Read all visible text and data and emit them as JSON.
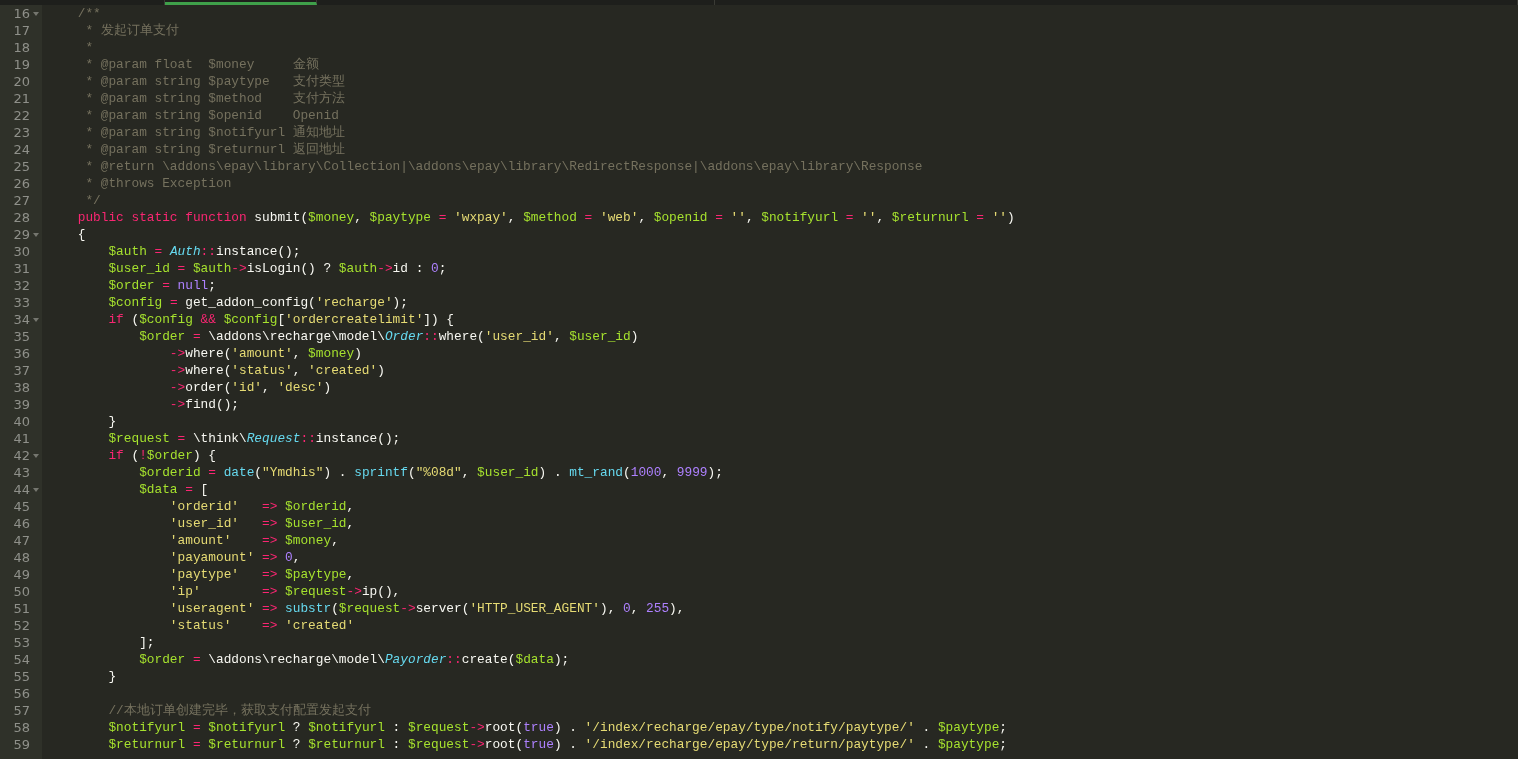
{
  "tabs": [
    {
      "selected": false
    },
    {
      "selected": true
    },
    {
      "selected": false
    },
    {
      "selected": false
    }
  ],
  "lines": [
    {
      "number": "16",
      "fold": true,
      "tokens": [
        {
          "kind": "comment",
          "text": "    /**"
        }
      ]
    },
    {
      "number": "17",
      "fold": false,
      "tokens": [
        {
          "kind": "comment",
          "text": "     * 发起订单支付"
        }
      ]
    },
    {
      "number": "18",
      "fold": false,
      "tokens": [
        {
          "kind": "comment",
          "text": "     *"
        }
      ]
    },
    {
      "number": "19",
      "fold": false,
      "tokens": [
        {
          "kind": "comment",
          "text": "     * @param float  $money     金额"
        }
      ]
    },
    {
      "number": "20",
      "fold": false,
      "tokens": [
        {
          "kind": "comment",
          "text": "     * @param string $paytype   支付类型"
        }
      ]
    },
    {
      "number": "21",
      "fold": false,
      "tokens": [
        {
          "kind": "comment",
          "text": "     * @param string $method    支付方法"
        }
      ]
    },
    {
      "number": "22",
      "fold": false,
      "tokens": [
        {
          "kind": "comment",
          "text": "     * @param string $openid    Openid"
        }
      ]
    },
    {
      "number": "23",
      "fold": false,
      "tokens": [
        {
          "kind": "comment",
          "text": "     * @param string $notifyurl 通知地址"
        }
      ]
    },
    {
      "number": "24",
      "fold": false,
      "tokens": [
        {
          "kind": "comment",
          "text": "     * @param string $returnurl 返回地址"
        }
      ]
    },
    {
      "number": "25",
      "fold": false,
      "tokens": [
        {
          "kind": "comment",
          "text": "     * @return \\addons\\epay\\library\\Collection|\\addons\\epay\\library\\RedirectResponse|\\addons\\epay\\library\\Response"
        }
      ]
    },
    {
      "number": "26",
      "fold": false,
      "tokens": [
        {
          "kind": "comment",
          "text": "     * @throws Exception"
        }
      ]
    },
    {
      "number": "27",
      "fold": false,
      "tokens": [
        {
          "kind": "comment",
          "text": "     */"
        }
      ]
    },
    {
      "number": "28",
      "fold": false,
      "tokens": [
        {
          "kind": "keyword",
          "text": "    public static function"
        },
        {
          "kind": "plain",
          "text": " submit("
        },
        {
          "kind": "variable",
          "text": "$money"
        },
        {
          "kind": "plain",
          "text": ", "
        },
        {
          "kind": "variable",
          "text": "$paytype"
        },
        {
          "kind": "keyword",
          "text": " = "
        },
        {
          "kind": "string",
          "text": "'wxpay'"
        },
        {
          "kind": "plain",
          "text": ", "
        },
        {
          "kind": "variable",
          "text": "$method"
        },
        {
          "kind": "keyword",
          "text": " = "
        },
        {
          "kind": "string",
          "text": "'web'"
        },
        {
          "kind": "plain",
          "text": ", "
        },
        {
          "kind": "variable",
          "text": "$openid"
        },
        {
          "kind": "keyword",
          "text": " = "
        },
        {
          "kind": "string",
          "text": "''"
        },
        {
          "kind": "plain",
          "text": ", "
        },
        {
          "kind": "variable",
          "text": "$notifyurl"
        },
        {
          "kind": "keyword",
          "text": " = "
        },
        {
          "kind": "string",
          "text": "''"
        },
        {
          "kind": "plain",
          "text": ", "
        },
        {
          "kind": "variable",
          "text": "$returnurl"
        },
        {
          "kind": "keyword",
          "text": " = "
        },
        {
          "kind": "string",
          "text": "''"
        },
        {
          "kind": "plain",
          "text": ")"
        }
      ]
    },
    {
      "number": "29",
      "fold": true,
      "tokens": [
        {
          "kind": "plain",
          "text": "    {"
        }
      ]
    },
    {
      "number": "30",
      "fold": false,
      "tokens": [
        {
          "kind": "variable",
          "text": "        $auth"
        },
        {
          "kind": "keyword",
          "text": " = "
        },
        {
          "kind": "class",
          "text": "Auth"
        },
        {
          "kind": "keyword",
          "text": "::"
        },
        {
          "kind": "plain",
          "text": "instance();"
        }
      ]
    },
    {
      "number": "31",
      "fold": false,
      "tokens": [
        {
          "kind": "variable",
          "text": "        $user_id"
        },
        {
          "kind": "keyword",
          "text": " = "
        },
        {
          "kind": "variable",
          "text": "$auth"
        },
        {
          "kind": "keyword",
          "text": "->"
        },
        {
          "kind": "plain",
          "text": "isLogin() ? "
        },
        {
          "kind": "variable",
          "text": "$auth"
        },
        {
          "kind": "keyword",
          "text": "->"
        },
        {
          "kind": "plain",
          "text": "id : "
        },
        {
          "kind": "number",
          "text": "0"
        },
        {
          "kind": "plain",
          "text": ";"
        }
      ]
    },
    {
      "number": "32",
      "fold": false,
      "tokens": [
        {
          "kind": "variable",
          "text": "        $order"
        },
        {
          "kind": "keyword",
          "text": " = "
        },
        {
          "kind": "number",
          "text": "null"
        },
        {
          "kind": "plain",
          "text": ";"
        }
      ]
    },
    {
      "number": "33",
      "fold": false,
      "tokens": [
        {
          "kind": "variable",
          "text": "        $config"
        },
        {
          "kind": "keyword",
          "text": " = "
        },
        {
          "kind": "plain",
          "text": "get_addon_config("
        },
        {
          "kind": "string",
          "text": "'recharge'"
        },
        {
          "kind": "plain",
          "text": ");"
        }
      ]
    },
    {
      "number": "34",
      "fold": true,
      "tokens": [
        {
          "kind": "keyword",
          "text": "        if"
        },
        {
          "kind": "plain",
          "text": " ("
        },
        {
          "kind": "variable",
          "text": "$config"
        },
        {
          "kind": "keyword",
          "text": " && "
        },
        {
          "kind": "variable",
          "text": "$config"
        },
        {
          "kind": "plain",
          "text": "["
        },
        {
          "kind": "string",
          "text": "'ordercreatelimit'"
        },
        {
          "kind": "plain",
          "text": "]) {"
        }
      ]
    },
    {
      "number": "35",
      "fold": false,
      "tokens": [
        {
          "kind": "variable",
          "text": "            $order"
        },
        {
          "kind": "keyword",
          "text": " = "
        },
        {
          "kind": "plain",
          "text": "\\addons\\recharge\\model\\"
        },
        {
          "kind": "class",
          "text": "Order"
        },
        {
          "kind": "keyword",
          "text": "::"
        },
        {
          "kind": "plain",
          "text": "where("
        },
        {
          "kind": "string",
          "text": "'user_id'"
        },
        {
          "kind": "plain",
          "text": ", "
        },
        {
          "kind": "variable",
          "text": "$user_id"
        },
        {
          "kind": "plain",
          "text": ")"
        }
      ]
    },
    {
      "number": "36",
      "fold": false,
      "tokens": [
        {
          "kind": "keyword",
          "text": "                ->"
        },
        {
          "kind": "plain",
          "text": "where("
        },
        {
          "kind": "string",
          "text": "'amount'"
        },
        {
          "kind": "plain",
          "text": ", "
        },
        {
          "kind": "variable",
          "text": "$money"
        },
        {
          "kind": "plain",
          "text": ")"
        }
      ]
    },
    {
      "number": "37",
      "fold": false,
      "tokens": [
        {
          "kind": "keyword",
          "text": "                ->"
        },
        {
          "kind": "plain",
          "text": "where("
        },
        {
          "kind": "string",
          "text": "'status'"
        },
        {
          "kind": "plain",
          "text": ", "
        },
        {
          "kind": "string",
          "text": "'created'"
        },
        {
          "kind": "plain",
          "text": ")"
        }
      ]
    },
    {
      "number": "38",
      "fold": false,
      "tokens": [
        {
          "kind": "keyword",
          "text": "                ->"
        },
        {
          "kind": "plain",
          "text": "order("
        },
        {
          "kind": "string",
          "text": "'id'"
        },
        {
          "kind": "plain",
          "text": ", "
        },
        {
          "kind": "string",
          "text": "'desc'"
        },
        {
          "kind": "plain",
          "text": ")"
        }
      ]
    },
    {
      "number": "39",
      "fold": false,
      "tokens": [
        {
          "kind": "keyword",
          "text": "                ->"
        },
        {
          "kind": "plain",
          "text": "find();"
        }
      ]
    },
    {
      "number": "40",
      "fold": false,
      "tokens": [
        {
          "kind": "plain",
          "text": "        }"
        }
      ]
    },
    {
      "number": "41",
      "fold": false,
      "tokens": [
        {
          "kind": "variable",
          "text": "        $request"
        },
        {
          "kind": "keyword",
          "text": " = "
        },
        {
          "kind": "plain",
          "text": "\\think\\"
        },
        {
          "kind": "class",
          "text": "Request"
        },
        {
          "kind": "keyword",
          "text": "::"
        },
        {
          "kind": "plain",
          "text": "instance();"
        }
      ]
    },
    {
      "number": "42",
      "fold": true,
      "tokens": [
        {
          "kind": "keyword",
          "text": "        if"
        },
        {
          "kind": "plain",
          "text": " ("
        },
        {
          "kind": "keyword",
          "text": "!"
        },
        {
          "kind": "variable",
          "text": "$order"
        },
        {
          "kind": "plain",
          "text": ") {"
        }
      ]
    },
    {
      "number": "43",
      "fold": false,
      "tokens": [
        {
          "kind": "variable",
          "text": "            $orderid"
        },
        {
          "kind": "keyword",
          "text": " = "
        },
        {
          "kind": "function",
          "text": "date"
        },
        {
          "kind": "plain",
          "text": "("
        },
        {
          "kind": "string",
          "text": "\"Ymdhis\""
        },
        {
          "kind": "plain",
          "text": ") . "
        },
        {
          "kind": "function",
          "text": "sprintf"
        },
        {
          "kind": "plain",
          "text": "("
        },
        {
          "kind": "string",
          "text": "\"%08d\""
        },
        {
          "kind": "plain",
          "text": ", "
        },
        {
          "kind": "variable",
          "text": "$user_id"
        },
        {
          "kind": "plain",
          "text": ") . "
        },
        {
          "kind": "function",
          "text": "mt_rand"
        },
        {
          "kind": "plain",
          "text": "("
        },
        {
          "kind": "number",
          "text": "1000"
        },
        {
          "kind": "plain",
          "text": ", "
        },
        {
          "kind": "number",
          "text": "9999"
        },
        {
          "kind": "plain",
          "text": ");"
        }
      ]
    },
    {
      "number": "44",
      "fold": true,
      "tokens": [
        {
          "kind": "variable",
          "text": "            $data"
        },
        {
          "kind": "keyword",
          "text": " = "
        },
        {
          "kind": "plain",
          "text": "["
        }
      ]
    },
    {
      "number": "45",
      "fold": false,
      "tokens": [
        {
          "kind": "string",
          "text": "                'orderid'"
        },
        {
          "kind": "keyword",
          "text": "   => "
        },
        {
          "kind": "variable",
          "text": "$orderid"
        },
        {
          "kind": "plain",
          "text": ","
        }
      ]
    },
    {
      "number": "46",
      "fold": false,
      "tokens": [
        {
          "kind": "string",
          "text": "                'user_id'"
        },
        {
          "kind": "keyword",
          "text": "   => "
        },
        {
          "kind": "variable",
          "text": "$user_id"
        },
        {
          "kind": "plain",
          "text": ","
        }
      ]
    },
    {
      "number": "47",
      "fold": false,
      "tokens": [
        {
          "kind": "string",
          "text": "                'amount'"
        },
        {
          "kind": "keyword",
          "text": "    => "
        },
        {
          "kind": "variable",
          "text": "$money"
        },
        {
          "kind": "plain",
          "text": ","
        }
      ]
    },
    {
      "number": "48",
      "fold": false,
      "tokens": [
        {
          "kind": "string",
          "text": "                'payamount'"
        },
        {
          "kind": "keyword",
          "text": " => "
        },
        {
          "kind": "number",
          "text": "0"
        },
        {
          "kind": "plain",
          "text": ","
        }
      ]
    },
    {
      "number": "49",
      "fold": false,
      "tokens": [
        {
          "kind": "string",
          "text": "                'paytype'"
        },
        {
          "kind": "keyword",
          "text": "   => "
        },
        {
          "kind": "variable",
          "text": "$paytype"
        },
        {
          "kind": "plain",
          "text": ","
        }
      ]
    },
    {
      "number": "50",
      "fold": false,
      "tokens": [
        {
          "kind": "string",
          "text": "                'ip'"
        },
        {
          "kind": "keyword",
          "text": "        => "
        },
        {
          "kind": "variable",
          "text": "$request"
        },
        {
          "kind": "keyword",
          "text": "->"
        },
        {
          "kind": "plain",
          "text": "ip(),"
        }
      ]
    },
    {
      "number": "51",
      "fold": false,
      "tokens": [
        {
          "kind": "string",
          "text": "                'useragent'"
        },
        {
          "kind": "keyword",
          "text": " => "
        },
        {
          "kind": "function",
          "text": "substr"
        },
        {
          "kind": "plain",
          "text": "("
        },
        {
          "kind": "variable",
          "text": "$request"
        },
        {
          "kind": "keyword",
          "text": "->"
        },
        {
          "kind": "plain",
          "text": "server("
        },
        {
          "kind": "string",
          "text": "'HTTP_USER_AGENT'"
        },
        {
          "kind": "plain",
          "text": "), "
        },
        {
          "kind": "number",
          "text": "0"
        },
        {
          "kind": "plain",
          "text": ", "
        },
        {
          "kind": "number",
          "text": "255"
        },
        {
          "kind": "plain",
          "text": "),"
        }
      ]
    },
    {
      "number": "52",
      "fold": false,
      "tokens": [
        {
          "kind": "string",
          "text": "                'status'"
        },
        {
          "kind": "keyword",
          "text": "    => "
        },
        {
          "kind": "string",
          "text": "'created'"
        }
      ]
    },
    {
      "number": "53",
      "fold": false,
      "tokens": [
        {
          "kind": "plain",
          "text": "            ];"
        }
      ]
    },
    {
      "number": "54",
      "fold": false,
      "tokens": [
        {
          "kind": "variable",
          "text": "            $order"
        },
        {
          "kind": "keyword",
          "text": " = "
        },
        {
          "kind": "plain",
          "text": "\\addons\\recharge\\model\\"
        },
        {
          "kind": "class",
          "text": "Payorder"
        },
        {
          "kind": "keyword",
          "text": "::"
        },
        {
          "kind": "plain",
          "text": "create("
        },
        {
          "kind": "variable",
          "text": "$data"
        },
        {
          "kind": "plain",
          "text": ");"
        }
      ]
    },
    {
      "number": "55",
      "fold": false,
      "tokens": [
        {
          "kind": "plain",
          "text": "        }"
        }
      ]
    },
    {
      "number": "56",
      "fold": false
    },
    {
      "number": "57",
      "fold": false,
      "tokens": [
        {
          "kind": "comment",
          "text": "        //本地订单创建完毕，获取支付配置发起支付"
        }
      ]
    },
    {
      "number": "58",
      "fold": false,
      "tokens": [
        {
          "kind": "variable",
          "text": "        $notifyurl"
        },
        {
          "kind": "keyword",
          "text": " = "
        },
        {
          "kind": "variable",
          "text": "$notifyurl"
        },
        {
          "kind": "plain",
          "text": " ? "
        },
        {
          "kind": "variable",
          "text": "$notifyurl"
        },
        {
          "kind": "plain",
          "text": " : "
        },
        {
          "kind": "variable",
          "text": "$request"
        },
        {
          "kind": "keyword",
          "text": "->"
        },
        {
          "kind": "plain",
          "text": "root("
        },
        {
          "kind": "number",
          "text": "true"
        },
        {
          "kind": "plain",
          "text": ") . "
        },
        {
          "kind": "string",
          "text": "'/index/recharge/epay/type/notify/paytype/'"
        },
        {
          "kind": "plain",
          "text": " . "
        },
        {
          "kind": "variable",
          "text": "$paytype"
        },
        {
          "kind": "plain",
          "text": ";"
        }
      ]
    },
    {
      "number": "59",
      "fold": false,
      "tokens": [
        {
          "kind": "variable",
          "text": "        $returnurl"
        },
        {
          "kind": "keyword",
          "text": " = "
        },
        {
          "kind": "variable",
          "text": "$returnurl"
        },
        {
          "kind": "plain",
          "text": " ? "
        },
        {
          "kind": "variable",
          "text": "$returnurl"
        },
        {
          "kind": "plain",
          "text": " : "
        },
        {
          "kind": "variable",
          "text": "$request"
        },
        {
          "kind": "keyword",
          "text": "->"
        },
        {
          "kind": "plain",
          "text": "root("
        },
        {
          "kind": "number",
          "text": "true"
        },
        {
          "kind": "plain",
          "text": ") . "
        },
        {
          "kind": "string",
          "text": "'/index/recharge/epay/type/return/paytype/'"
        },
        {
          "kind": "plain",
          "text": " . "
        },
        {
          "kind": "variable",
          "text": "$paytype"
        },
        {
          "kind": "plain",
          "text": ";"
        }
      ]
    }
  ]
}
